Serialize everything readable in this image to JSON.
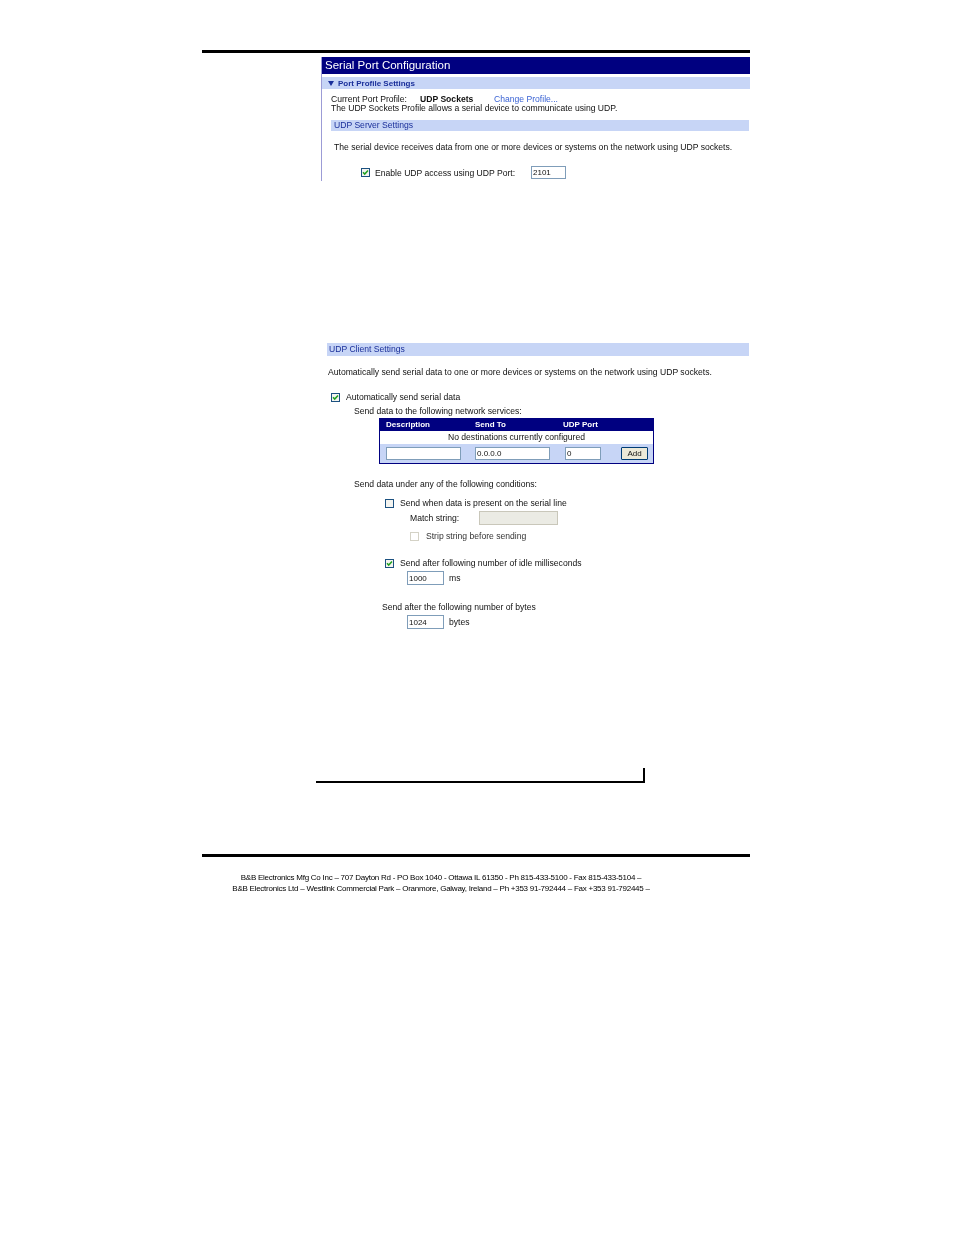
{
  "server_panel": {
    "title": "Serial Port Configuration",
    "profile_section": {
      "label": "Port Profile Settings",
      "expanded": true
    },
    "current_profile": {
      "label": "Current Port Profile:",
      "value": "UDP Sockets",
      "link": "Change Profile..."
    },
    "profile_description": "The UDP Sockets Profile allows a serial device to communicate using UDP.",
    "server_section": {
      "label": "UDP Server Settings",
      "description": "The serial device receives data from one or more devices or systems on the network using UDP sockets.",
      "enable_udp": {
        "label": "Enable UDP access using UDP Port:",
        "checked": true,
        "port": "2101"
      }
    }
  },
  "client_panel": {
    "section_label": "UDP Client Settings",
    "description": "Automatically send serial data to one or more devices or systems on the network using UDP sockets.",
    "auto_send": {
      "label": "Automatically send serial data",
      "checked": true
    },
    "services_label": "Send data to the following network services:",
    "destinations_table": {
      "columns": [
        "Description",
        "Send To",
        "UDP Port"
      ],
      "empty_message": "No destinations currently configured",
      "new_entry": {
        "send_to": "0.0.0.0",
        "udp_port": "0",
        "button": "Add"
      }
    },
    "conditions_label": "Send data under any of the following conditions:",
    "conditions": [
      {
        "kind": "checkbox",
        "label": "Send when data is present on the serial line",
        "checked": false,
        "match_string": {
          "label": "Match string:",
          "disabled": true
        },
        "strip": {
          "label": "Strip string before sending",
          "checked": false,
          "disabled": true
        }
      },
      {
        "kind": "checkbox",
        "label": "Send after following number of idle milliseconds",
        "checked": true,
        "value": "1000",
        "unit": "ms"
      },
      {
        "kind": "plain",
        "label": "Send after the following number of bytes",
        "value": "1024",
        "unit": "bytes"
      }
    ]
  },
  "footer": {
    "lines": [
      "B&B Electronics Mfg Co Inc – 707 Dayton Rd - PO Box 1040 - Ottawa IL 61350 - Ph 815-433-5100 - Fax 815-433-5104 –",
      "B&B Electronics Ltd – Westlink Commercial Park – Oranmore, Galway, Ireland – Ph +353 91-792444 – Fax +353 91-792445 –"
    ]
  }
}
